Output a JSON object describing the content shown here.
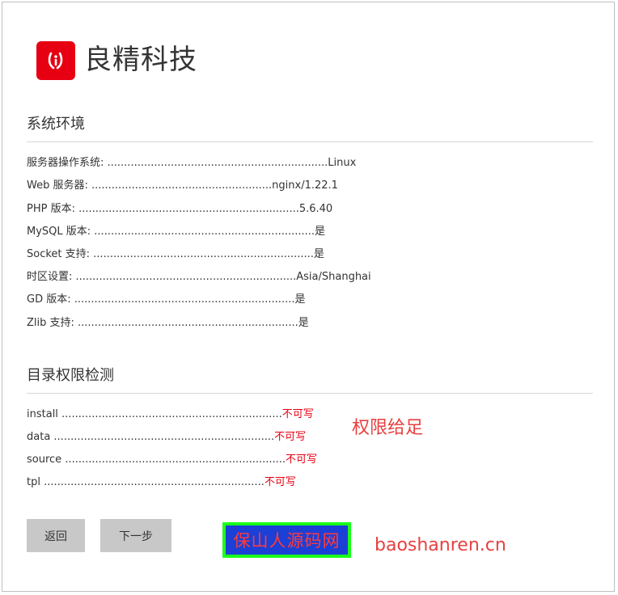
{
  "brand": {
    "name": "良精科技",
    "logo_color": "#e60012"
  },
  "sections": {
    "env_title": "系统环境",
    "dir_title": "目录权限检测"
  },
  "env_rows": [
    {
      "label": "服务器操作系统: ",
      "dots": "..................................................................",
      "value": "Linux"
    },
    {
      "label": "Web 服务器: ",
      "dots": "......................................................",
      "value": "nginx/1.22.1"
    },
    {
      "label": "PHP 版本: ",
      "dots": "..................................................................",
      "value": "5.6.40"
    },
    {
      "label": "MySQL 版本: ",
      "dots": "..................................................................",
      "value": "是"
    },
    {
      "label": "Socket 支持: ",
      "dots": "..................................................................",
      "value": "是"
    },
    {
      "label": "时区设置: ",
      "dots": "..................................................................",
      "value": "Asia/Shanghai"
    },
    {
      "label": "GD 版本: ",
      "dots": "..................................................................",
      "value": "是"
    },
    {
      "label": "Zlib 支持: ",
      "dots": "..................................................................",
      "value": "是"
    }
  ],
  "dir_rows": [
    {
      "label": "install ",
      "dots": "..................................................................",
      "status": "不可写"
    },
    {
      "label": "data ",
      "dots": "..................................................................",
      "status": "不可写"
    },
    {
      "label": "source ",
      "dots": "..................................................................",
      "status": "不可写"
    },
    {
      "label": "tpl ",
      "dots": "..................................................................",
      "status": "不可写"
    }
  ],
  "annotation": "权限给足",
  "buttons": {
    "back": "返回",
    "next": "下一步"
  },
  "watermark": {
    "text": "保山人源码网",
    "url": "baoshanren.cn"
  },
  "colors": {
    "status_red": "#e60012",
    "button_bg": "#c8c8c8"
  }
}
